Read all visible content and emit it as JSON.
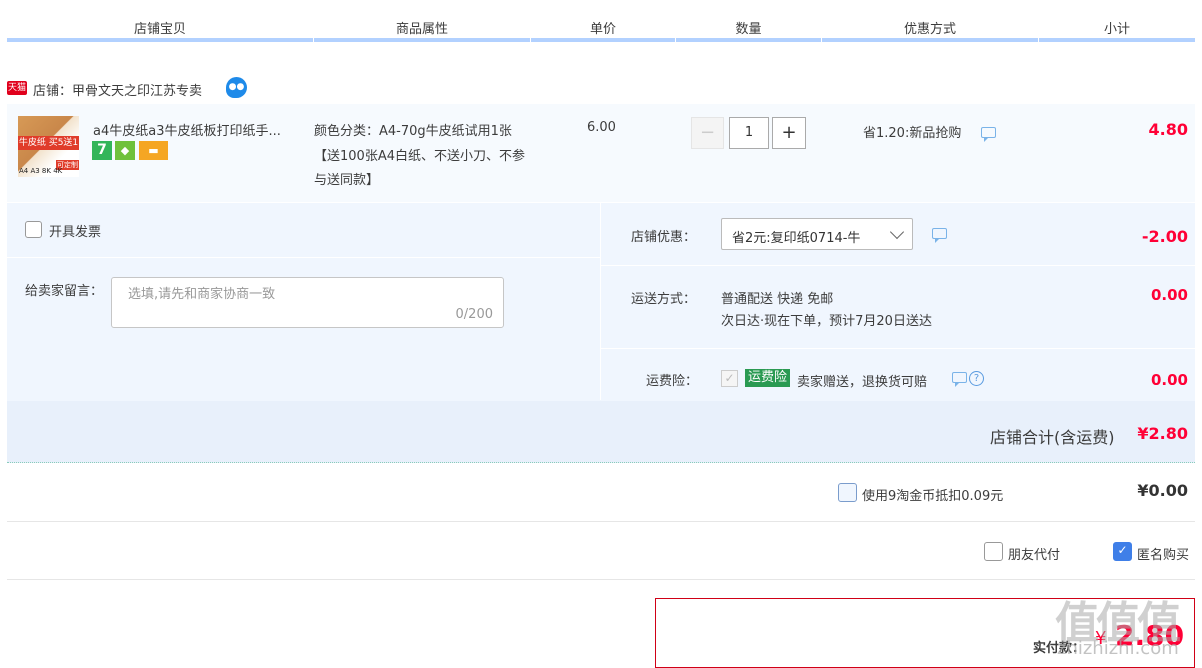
{
  "columns": [
    "店铺宝贝",
    "商品属性",
    "单价",
    "数量",
    "优惠方式",
    "小计"
  ],
  "shop": {
    "badge": "天猫",
    "name": "店铺：甲骨文天之印江苏专卖"
  },
  "item": {
    "thumb_banner": "牛皮纸 买5送1",
    "thumb_sizes": "A4 A3 8K 4K",
    "thumb_custom": "可定制",
    "title": "a4牛皮纸a3牛皮纸板打印纸手...",
    "service_icons": [
      {
        "name": "seven-day-return-icon",
        "glyph": "7",
        "color": "#33b55a"
      },
      {
        "name": "guarantee-icon",
        "glyph": "◆",
        "color": "#6fc13b"
      },
      {
        "name": "credit-card-icon",
        "glyph": "▬",
        "color": "#f5a623"
      }
    ],
    "sku": "颜色分类：A4-70g牛皮纸试用1张【送100张A4白纸、不送小刀、不参与送同款】",
    "price": "6.00",
    "qty_minus": "−",
    "qty": "1",
    "qty_plus": "+",
    "promo": "省1.20:新品抢购",
    "subtotal": "4.80"
  },
  "options": {
    "invoice_label": "开具发票",
    "message_label": "给卖家留言：",
    "message_placeholder": "选填,请先和商家协商一致",
    "message_count": "0/200",
    "discount_label": "店铺优惠：",
    "discount_value": "省2元:复印纸0714-牛",
    "discount_amount": "-2.00",
    "shipping_label": "运送方式：",
    "shipping_line1": "普通配送 快递 免邮",
    "shipping_line2": "次日达·现在下单，预计7月20日送达",
    "shipping_amount": "0.00",
    "insurance_label": "运费险：",
    "insurance_tag": "运费险",
    "insurance_text": "卖家赠送，退换货可赔",
    "insurance_amount": "0.00",
    "insurance_check": "✓",
    "help_glyph": "?"
  },
  "shop_total": {
    "label": "店铺合计(含运费)",
    "value": "¥2.80"
  },
  "coins": {
    "label": "使用9淘金币抵扣0.09元",
    "value": "¥0.00"
  },
  "friend_pay": "朋友代付",
  "anonymous": "匿名购买",
  "anonymous_check": "✓",
  "final": {
    "label": "实付款：",
    "currency": "¥",
    "value": "2.80"
  },
  "watermark": {
    "main": "值值值",
    "sub": "zhizhizhi.com"
  }
}
